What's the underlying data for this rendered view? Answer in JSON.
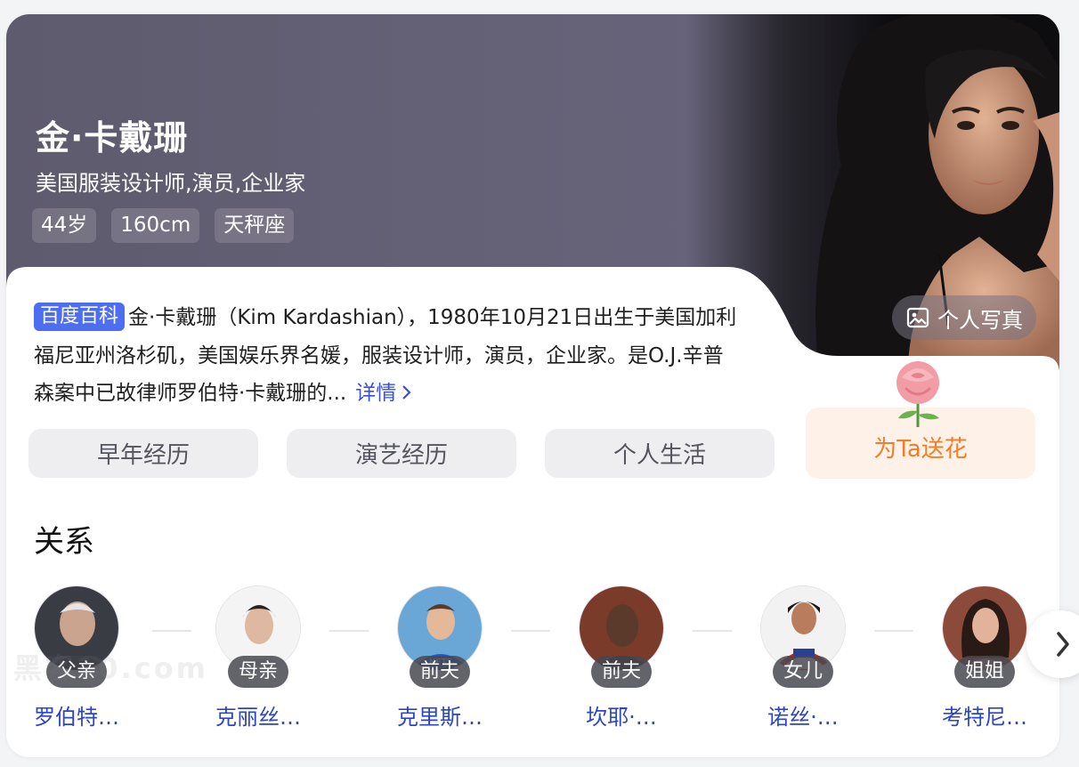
{
  "profile": {
    "name": "金·卡戴珊",
    "subtitle": "美国服装设计师,演员,企业家",
    "tags": [
      "44岁",
      "160cm",
      "天秤座"
    ],
    "photo_button_label": "个人写真"
  },
  "intro": {
    "source_badge": "百度百科",
    "text": "金·卡戴珊（Kim Kardashian），1980年10月21日出生于美国加利福尼亚州洛杉矶，美国娱乐界名媛，服装设计师，演员，企业家。是O.J.辛普森案中已故律师罗伯特·卡戴珊的...",
    "more_link": "详情",
    "more_icon": "chevron-right-icon"
  },
  "sections": [
    "早年经历",
    "演艺经历",
    "个人生活"
  ],
  "flower": {
    "label": "为Ta送花",
    "icon": "rose-icon"
  },
  "relations": {
    "title": "关系",
    "items": [
      {
        "role": "父亲",
        "name": "罗伯特…"
      },
      {
        "role": "母亲",
        "name": "克丽丝…"
      },
      {
        "role": "前夫",
        "name": "克里斯…"
      },
      {
        "role": "前夫",
        "name": "坎耶·…"
      },
      {
        "role": "女儿",
        "name": "诺丝·…"
      },
      {
        "role": "姐姐",
        "name": "考特尼…"
      }
    ],
    "next_icon": "chevron-right-icon"
  },
  "watermark": "黑客10.com",
  "colors": {
    "hero_bg": "#65617a",
    "link": "#2b45c6",
    "badge": "#4e6ef2",
    "flower_text": "#ef7d29",
    "flower_bg": "#fdf1e8"
  }
}
